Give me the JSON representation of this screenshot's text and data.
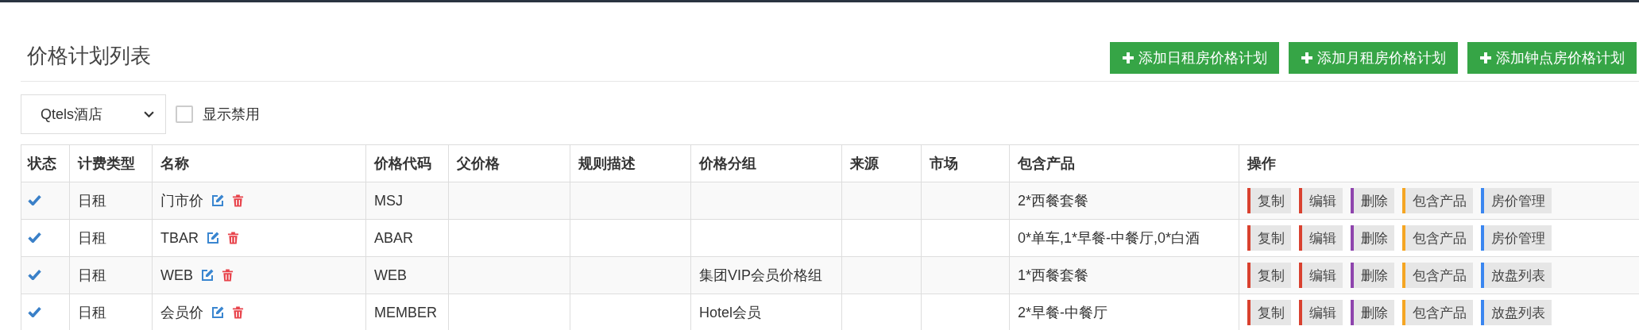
{
  "page": {
    "title": "价格计划列表"
  },
  "add_buttons": [
    {
      "label": "添加日租房价格计划"
    },
    {
      "label": "添加月租房价格计划"
    },
    {
      "label": "添加钟点房价格计划"
    }
  ],
  "filters": {
    "hotel_select": {
      "value": "Qtels酒店"
    },
    "show_disabled": {
      "label": "显示禁用",
      "checked": false
    }
  },
  "table": {
    "columns": [
      "状态",
      "计费类型",
      "名称",
      "价格代码",
      "父价格",
      "规则描述",
      "价格分组",
      "来源",
      "市场",
      "包含产品",
      "操作"
    ],
    "rows": [
      {
        "enabled": true,
        "billing_type": "日租",
        "name": "门市价",
        "code": "MSJ",
        "products": "2*西餐套餐",
        "actions": [
          {
            "label": "复制",
            "color": "#d9412f"
          },
          {
            "label": "编辑",
            "color": "#d9412f"
          },
          {
            "label": "删除",
            "color": "#8e44ad"
          },
          {
            "label": "包含产品",
            "color": "#f5a623"
          },
          {
            "label": "房价管理",
            "color": "#3a86f0"
          }
        ]
      },
      {
        "enabled": true,
        "billing_type": "日租",
        "name": "TBAR",
        "code": "ABAR",
        "products": "0*单车,1*早餐-中餐厅,0*白酒",
        "actions": [
          {
            "label": "复制",
            "color": "#d9412f"
          },
          {
            "label": "编辑",
            "color": "#d9412f"
          },
          {
            "label": "删除",
            "color": "#8e44ad"
          },
          {
            "label": "包含产品",
            "color": "#f5a623"
          },
          {
            "label": "房价管理",
            "color": "#3a86f0"
          }
        ]
      },
      {
        "enabled": true,
        "billing_type": "日租",
        "name": "WEB",
        "code": "WEB",
        "price_group": "集团VIP会员价格组",
        "products": "1*西餐套餐",
        "actions": [
          {
            "label": "复制",
            "color": "#d9412f"
          },
          {
            "label": "编辑",
            "color": "#d9412f"
          },
          {
            "label": "删除",
            "color": "#8e44ad"
          },
          {
            "label": "包含产品",
            "color": "#f5a623"
          },
          {
            "label": "放盘列表",
            "color": "#3a86f0"
          }
        ]
      },
      {
        "enabled": true,
        "billing_type": "日租",
        "name": "会员价",
        "code": "MEMBER",
        "price_group": "Hotel会员",
        "products": "2*早餐-中餐厅",
        "actions": [
          {
            "label": "复制",
            "color": "#d9412f"
          },
          {
            "label": "编辑",
            "color": "#d9412f"
          },
          {
            "label": "删除",
            "color": "#8e44ad"
          },
          {
            "label": "包含产品",
            "color": "#f5a623"
          },
          {
            "label": "放盘列表",
            "color": "#3a86f0"
          }
        ]
      }
    ]
  }
}
